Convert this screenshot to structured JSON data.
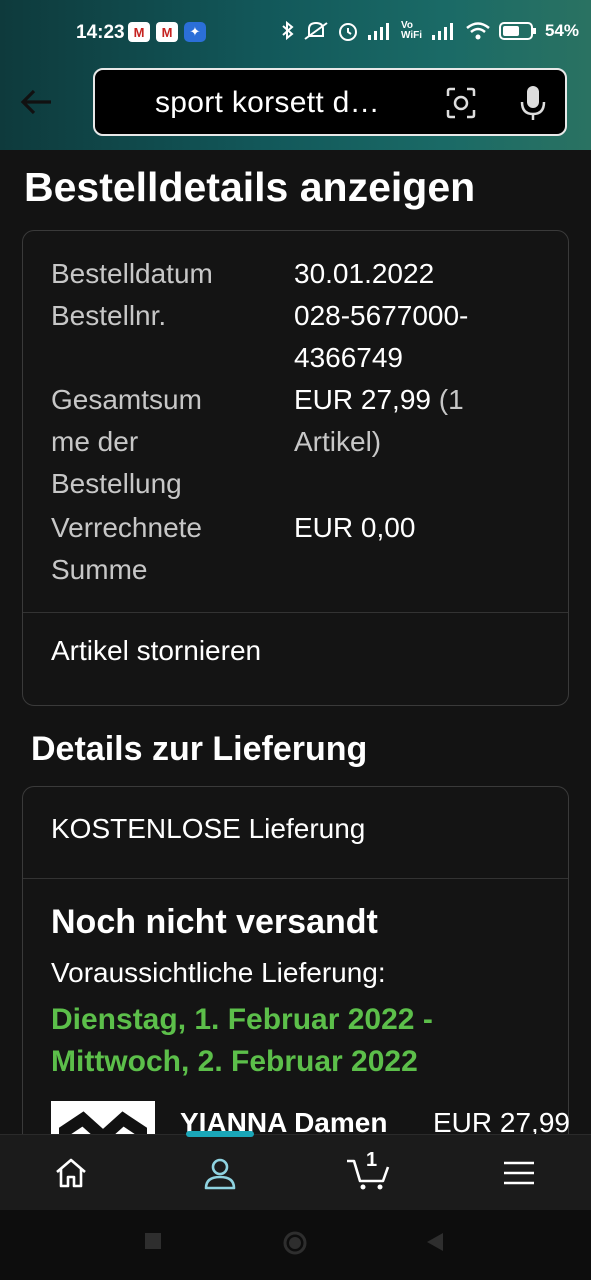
{
  "status_bar": {
    "time": "14:23",
    "left_icons": [
      "gmail-icon",
      "gmail-icon",
      "app-notification-icon"
    ],
    "right_icons": [
      "bluetooth-icon",
      "mute-icon",
      "alarm-icon",
      "signal-icon",
      "vowifi-icon",
      "signal-icon",
      "wifi-icon",
      "battery-icon"
    ],
    "vowifi_label": "Vo WiFi",
    "battery_percent": "54%"
  },
  "search": {
    "query": "sport korsett d…",
    "icons": [
      "camera-scan-icon",
      "microphone-icon"
    ]
  },
  "page": {
    "title": "Bestelldetails anzeigen"
  },
  "order": {
    "date_label": "Bestelldatum",
    "date_value": "30.01.2022",
    "number_label": "Bestellnr.",
    "number_value_line1": "028-5677000-",
    "number_value_line2": "4366749",
    "total_label_line1": "Gesamtsum",
    "total_label_line2": "me der",
    "total_label_line3": "Bestellung",
    "total_value": "EUR 27,99",
    "total_items_line1": "(1",
    "total_items_line2": "Artikel)",
    "settled_label_line1": "Verrechnete",
    "settled_label_line2": "Summe",
    "settled_value": "EUR 0,00",
    "cancel_label": "Artikel stornieren"
  },
  "delivery": {
    "section_title": "Details zur Lieferung",
    "shipping_label": "KOSTENLOSE Lieferung",
    "status": "Noch nicht versandt",
    "expected_label": "Voraussichtliche Lieferung:",
    "date_range_line1": "Dienstag, 1. Februar 2022 -",
    "date_range_line2": "Mittwoch, 2. Februar 2022",
    "product_name": "YIANNA Damen",
    "product_price": "EUR 27,99"
  },
  "bottom_nav": {
    "items": [
      "home-icon",
      "account-icon",
      "cart-icon",
      "menu-icon"
    ],
    "active": "account-icon",
    "cart_count": "1"
  },
  "colors": {
    "background": "#131313",
    "accent_green": "#5cbf4a",
    "active_teal": "#1aa6b8"
  }
}
